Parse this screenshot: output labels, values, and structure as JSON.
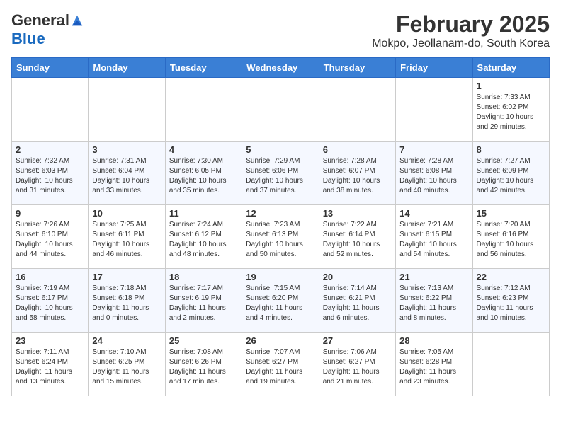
{
  "header": {
    "logo_general": "General",
    "logo_blue": "Blue",
    "title": "February 2025",
    "subtitle": "Mokpo, Jeollanam-do, South Korea"
  },
  "weekdays": [
    "Sunday",
    "Monday",
    "Tuesday",
    "Wednesday",
    "Thursday",
    "Friday",
    "Saturday"
  ],
  "weeks": [
    [
      {
        "day": "",
        "info": ""
      },
      {
        "day": "",
        "info": ""
      },
      {
        "day": "",
        "info": ""
      },
      {
        "day": "",
        "info": ""
      },
      {
        "day": "",
        "info": ""
      },
      {
        "day": "",
        "info": ""
      },
      {
        "day": "1",
        "info": "Sunrise: 7:33 AM\nSunset: 6:02 PM\nDaylight: 10 hours\nand 29 minutes."
      }
    ],
    [
      {
        "day": "2",
        "info": "Sunrise: 7:32 AM\nSunset: 6:03 PM\nDaylight: 10 hours\nand 31 minutes."
      },
      {
        "day": "3",
        "info": "Sunrise: 7:31 AM\nSunset: 6:04 PM\nDaylight: 10 hours\nand 33 minutes."
      },
      {
        "day": "4",
        "info": "Sunrise: 7:30 AM\nSunset: 6:05 PM\nDaylight: 10 hours\nand 35 minutes."
      },
      {
        "day": "5",
        "info": "Sunrise: 7:29 AM\nSunset: 6:06 PM\nDaylight: 10 hours\nand 37 minutes."
      },
      {
        "day": "6",
        "info": "Sunrise: 7:28 AM\nSunset: 6:07 PM\nDaylight: 10 hours\nand 38 minutes."
      },
      {
        "day": "7",
        "info": "Sunrise: 7:28 AM\nSunset: 6:08 PM\nDaylight: 10 hours\nand 40 minutes."
      },
      {
        "day": "8",
        "info": "Sunrise: 7:27 AM\nSunset: 6:09 PM\nDaylight: 10 hours\nand 42 minutes."
      }
    ],
    [
      {
        "day": "9",
        "info": "Sunrise: 7:26 AM\nSunset: 6:10 PM\nDaylight: 10 hours\nand 44 minutes."
      },
      {
        "day": "10",
        "info": "Sunrise: 7:25 AM\nSunset: 6:11 PM\nDaylight: 10 hours\nand 46 minutes."
      },
      {
        "day": "11",
        "info": "Sunrise: 7:24 AM\nSunset: 6:12 PM\nDaylight: 10 hours\nand 48 minutes."
      },
      {
        "day": "12",
        "info": "Sunrise: 7:23 AM\nSunset: 6:13 PM\nDaylight: 10 hours\nand 50 minutes."
      },
      {
        "day": "13",
        "info": "Sunrise: 7:22 AM\nSunset: 6:14 PM\nDaylight: 10 hours\nand 52 minutes."
      },
      {
        "day": "14",
        "info": "Sunrise: 7:21 AM\nSunset: 6:15 PM\nDaylight: 10 hours\nand 54 minutes."
      },
      {
        "day": "15",
        "info": "Sunrise: 7:20 AM\nSunset: 6:16 PM\nDaylight: 10 hours\nand 56 minutes."
      }
    ],
    [
      {
        "day": "16",
        "info": "Sunrise: 7:19 AM\nSunset: 6:17 PM\nDaylight: 10 hours\nand 58 minutes."
      },
      {
        "day": "17",
        "info": "Sunrise: 7:18 AM\nSunset: 6:18 PM\nDaylight: 11 hours\nand 0 minutes."
      },
      {
        "day": "18",
        "info": "Sunrise: 7:17 AM\nSunset: 6:19 PM\nDaylight: 11 hours\nand 2 minutes."
      },
      {
        "day": "19",
        "info": "Sunrise: 7:15 AM\nSunset: 6:20 PM\nDaylight: 11 hours\nand 4 minutes."
      },
      {
        "day": "20",
        "info": "Sunrise: 7:14 AM\nSunset: 6:21 PM\nDaylight: 11 hours\nand 6 minutes."
      },
      {
        "day": "21",
        "info": "Sunrise: 7:13 AM\nSunset: 6:22 PM\nDaylight: 11 hours\nand 8 minutes."
      },
      {
        "day": "22",
        "info": "Sunrise: 7:12 AM\nSunset: 6:23 PM\nDaylight: 11 hours\nand 10 minutes."
      }
    ],
    [
      {
        "day": "23",
        "info": "Sunrise: 7:11 AM\nSunset: 6:24 PM\nDaylight: 11 hours\nand 13 minutes."
      },
      {
        "day": "24",
        "info": "Sunrise: 7:10 AM\nSunset: 6:25 PM\nDaylight: 11 hours\nand 15 minutes."
      },
      {
        "day": "25",
        "info": "Sunrise: 7:08 AM\nSunset: 6:26 PM\nDaylight: 11 hours\nand 17 minutes."
      },
      {
        "day": "26",
        "info": "Sunrise: 7:07 AM\nSunset: 6:27 PM\nDaylight: 11 hours\nand 19 minutes."
      },
      {
        "day": "27",
        "info": "Sunrise: 7:06 AM\nSunset: 6:27 PM\nDaylight: 11 hours\nand 21 minutes."
      },
      {
        "day": "28",
        "info": "Sunrise: 7:05 AM\nSunset: 6:28 PM\nDaylight: 11 hours\nand 23 minutes."
      },
      {
        "day": "",
        "info": ""
      }
    ]
  ]
}
